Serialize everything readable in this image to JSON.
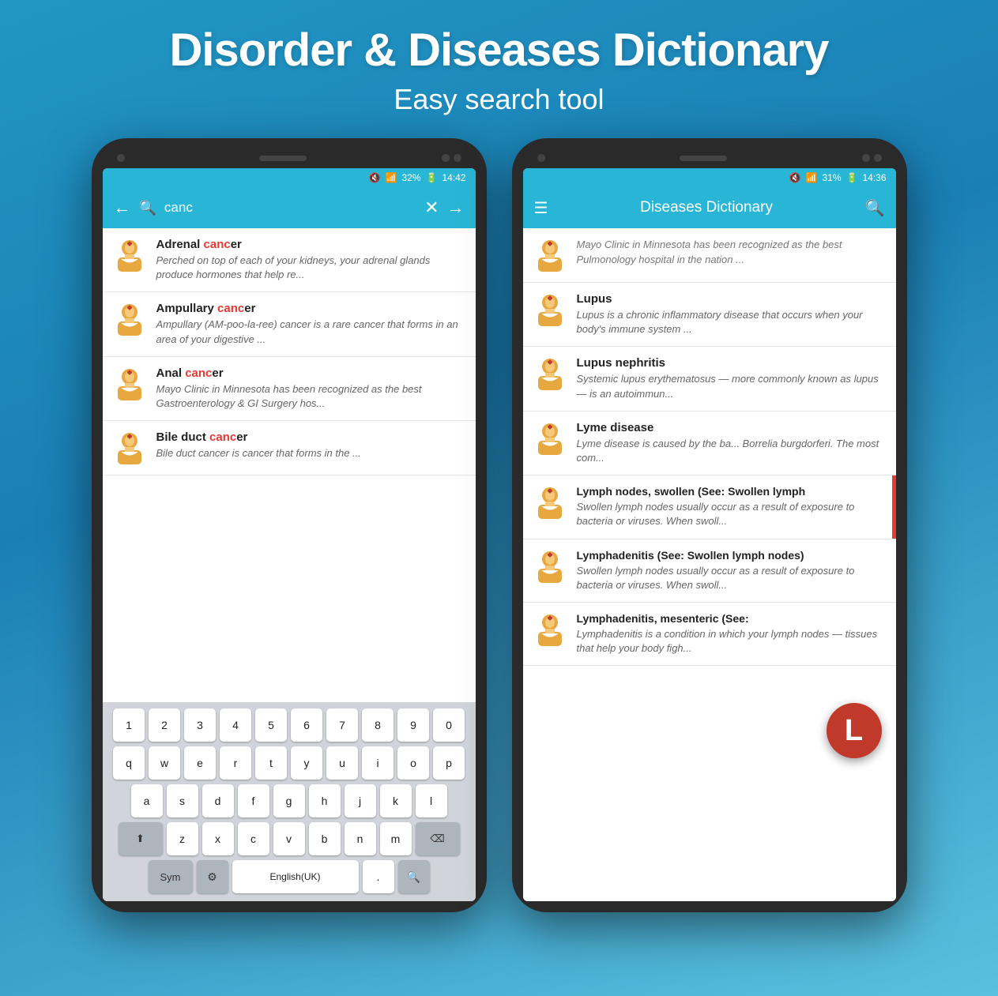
{
  "header": {
    "title": "Disorder & Diseases Dictionary",
    "subtitle": "Easy search tool"
  },
  "phone_left": {
    "status": {
      "mute": "🔇",
      "signal": "📶",
      "battery_pct": "32%",
      "battery_icon": "🔋",
      "time": "14:42"
    },
    "search_query": "canc",
    "results": [
      {
        "title_prefix": "Adrenal ",
        "highlight": "canc",
        "title_suffix": "er",
        "desc": "Perched on top of each of your kidneys, your adrenal glands produce hormones that help re..."
      },
      {
        "title_prefix": "Ampullary ",
        "highlight": "canc",
        "title_suffix": "er",
        "desc": "Ampullary (AM-poo-la-ree) cancer is a rare cancer that forms in an area of your digestive ..."
      },
      {
        "title_prefix": "Anal ",
        "highlight": "canc",
        "title_suffix": "er",
        "desc": "Mayo Clinic in Minnesota has been recognized as the best Gastroenterology & GI Surgery hos..."
      },
      {
        "title_prefix": "Bile duct ",
        "highlight": "canc",
        "title_suffix": "er",
        "desc": "Bile duct cancer is cancer that forms in the ..."
      }
    ],
    "keyboard": {
      "row1": [
        "1",
        "2",
        "3",
        "4",
        "5",
        "6",
        "7",
        "8",
        "9",
        "0"
      ],
      "row2": [
        "q",
        "w",
        "e",
        "r",
        "t",
        "y",
        "u",
        "i",
        "o",
        "p"
      ],
      "row3": [
        "a",
        "s",
        "d",
        "f",
        "g",
        "h",
        "j",
        "k",
        "l"
      ],
      "row4": [
        "z",
        "x",
        "c",
        "v",
        "b",
        "n",
        "m"
      ],
      "bottom": [
        "Sym",
        "⚙",
        "English(UK)",
        ".",
        "🔍"
      ]
    }
  },
  "phone_right": {
    "status": {
      "mute": "🔇",
      "signal": "📶",
      "battery_pct": "31%",
      "battery_icon": "🔋",
      "time": "14:36"
    },
    "app_title": "Diseases Dictionary",
    "results": [
      {
        "title": "",
        "desc": "Mayo Clinic in Minnesota has been recognized as the best Pulmonology hospital in the nation ..."
      },
      {
        "title": "Lupus",
        "desc": "Lupus is a chronic inflammatory disease that occurs when your body's immune system ..."
      },
      {
        "title": "Lupus nephritis",
        "desc": "Systemic lupus erythematosus — more commonly known as lupus — is an autoimmun..."
      },
      {
        "title": "Lyme disease",
        "desc": "Lyme disease is caused by the ba... Borrelia burgdorferi. The most com..."
      },
      {
        "title": "Lymph nodes, swollen (See: Swollen lymph",
        "desc": "Swollen lymph nodes usually occur as a result of exposure to bacteria or viruses. When swoll..."
      },
      {
        "title": "Lymphadenitis (See: Swollen lymph nodes)",
        "desc": "Swollen lymph nodes usually occur as a result of exposure to bacteria or viruses. When swoll..."
      },
      {
        "title": "Lymphadenitis, mesenteric (See:",
        "desc": "Lymphadenitis is a condition in which your lymph nodes — tissues that help your body figh..."
      }
    ],
    "float_letter": "L"
  }
}
